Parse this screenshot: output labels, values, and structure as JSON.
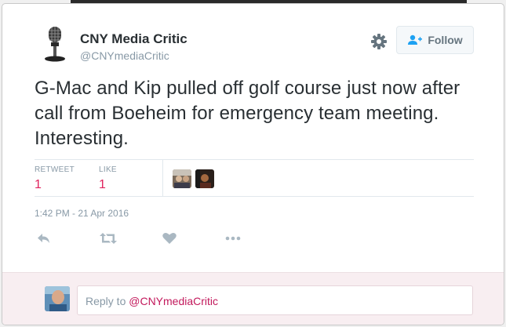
{
  "author": {
    "name": "CNY Media Critic",
    "handle": "@CNYmediaCritic",
    "avatar_icon": "microphone-icon"
  },
  "header": {
    "follow_label": "Follow",
    "follow_icon": "add-user-icon",
    "settings_icon": "gear-icon"
  },
  "tweet": {
    "text": "G-Mac and Kip pulled off golf course just now after call from Boeheim for emergency team meeting. Interesting.",
    "timestamp": "1:42 PM - 21 Apr 2016"
  },
  "stats": {
    "retweet_label": "RETWEET",
    "retweet_count": "1",
    "like_label": "LIKE",
    "like_count": "1"
  },
  "actions": {
    "reply_icon": "reply-icon",
    "retweet_icon": "retweet-icon",
    "like_icon": "heart-icon",
    "more_icon": "more-icon"
  },
  "reply": {
    "prefix": "Reply to ",
    "mention": "@CNYmediaCritic"
  },
  "colors": {
    "like_count": "#e0245e",
    "muted": "#8899a6",
    "reply_background": "#f8eef1"
  }
}
